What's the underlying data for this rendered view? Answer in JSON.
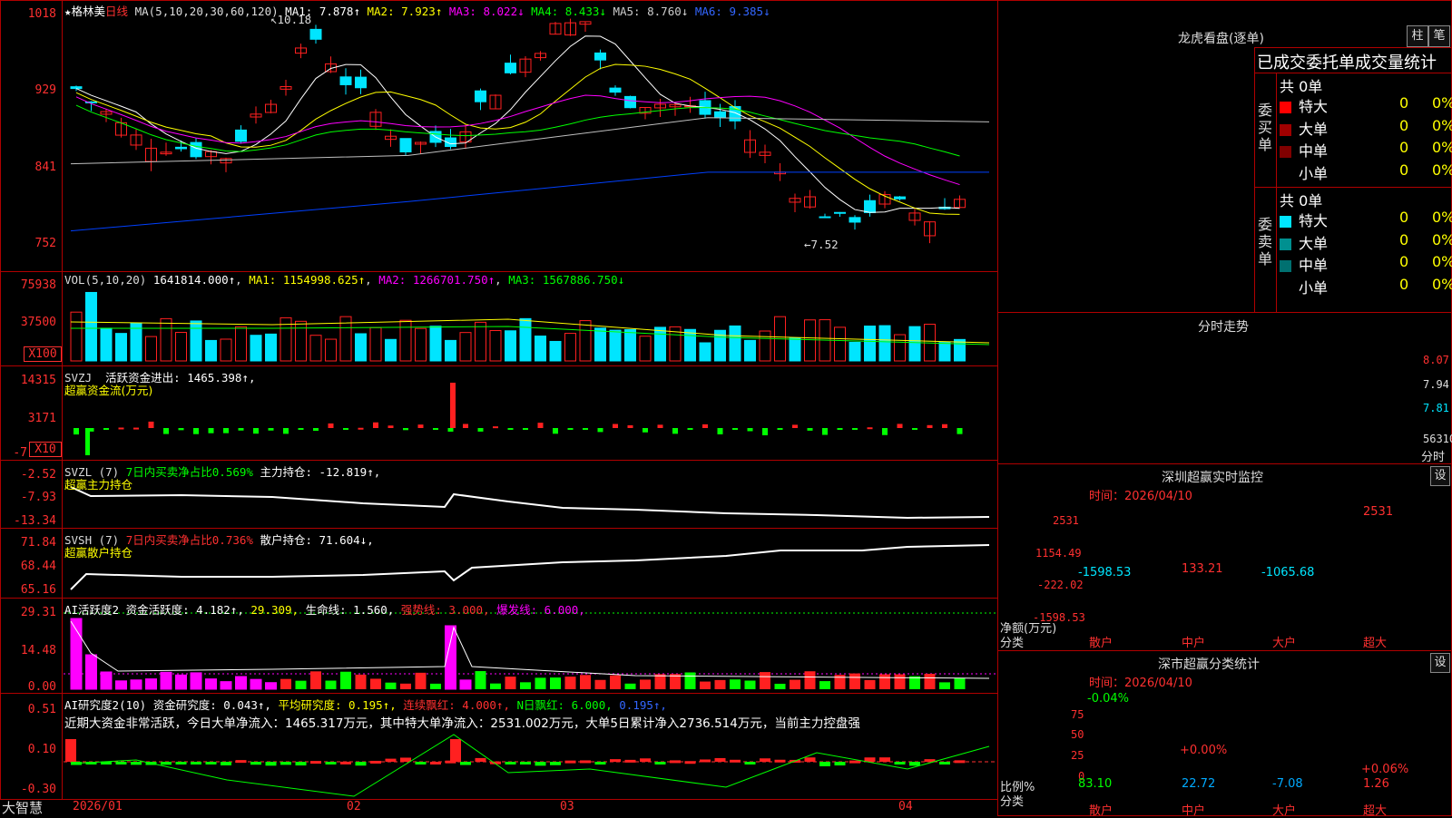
{
  "colors": {
    "up": "#ff2020",
    "down": "#00e5ff",
    "grid": "#b00000",
    "ma1": "#ffffff",
    "ma2": "#ffff00",
    "ma3": "#ff00ff",
    "ma4": "#00ff00",
    "ma5": "#c0c0c0",
    "ma6": "#0040ff"
  },
  "main": {
    "name": "格林美",
    "period": "日线",
    "ma_label": "MA(5,10,20,30,60,120)",
    "ma": [
      {
        "k": "MA1",
        "v": "7.878↑"
      },
      {
        "k": "MA2",
        "v": "7.923↑"
      },
      {
        "k": "MA3",
        "v": "8.022↓"
      },
      {
        "k": "MA4",
        "v": "8.433↓"
      },
      {
        "k": "MA5",
        "v": "8.760↓"
      },
      {
        "k": "MA6",
        "v": "9.385↓"
      }
    ],
    "y_ticks": [
      "1018",
      "929",
      "841",
      "752"
    ],
    "high_label": "10.18",
    "low_label": "7.52"
  },
  "vol": {
    "label": "VOL(5,10,20)",
    "value": "1641814.000↑",
    "ma1": "MA1: 1154998.625↑",
    "ma2": "MA2: 1266701.750↑",
    "ma3": "MA3: 1567886.750↓",
    "y_ticks": [
      "75938",
      "37500"
    ],
    "unit": "X100"
  },
  "svzj": {
    "label": "SVZJ",
    "desc": "活跃资金进出: 1465.398↑,",
    "sub": "超赢资金流(万元)",
    "y_ticks": [
      "14315",
      "3171",
      "-7"
    ],
    "unit": "X10"
  },
  "svzl": {
    "label": "SVZL (7)",
    "desc1": "7日内买卖净占比0.569%",
    "desc2": "主力持仓: -12.819↑,",
    "sub": "超赢主力持仓",
    "y_ticks": [
      "-2.52",
      "-7.93",
      "-13.34"
    ]
  },
  "svsh": {
    "label": "SVSH (7)",
    "desc1": "7日内买卖净占比0.736%",
    "desc2": "散户持仓: 71.604↓,",
    "sub": "超赢散户持仓",
    "y_ticks": [
      "71.84",
      "68.44",
      "65.16"
    ]
  },
  "ai1": {
    "label": "AI活跃度2",
    "v1": "资金活跃度: 4.182↑,",
    "v2": "29.309,",
    "v3": "生命线: 1.560,",
    "v4": "强势线: 3.000,",
    "v5": "爆发线: 6.000,",
    "y_ticks": [
      "29.31",
      "14.48",
      "0.00"
    ]
  },
  "ai2": {
    "label": "AI研究度2(10)",
    "v1": "资金研究度: 0.043↑,",
    "v2": "平均研究度: 0.195↑,",
    "v3": "连续飘红: 4.000↑,",
    "v4": "N日飘红: 6.000,",
    "v5": "0.195↑,",
    "text": "近期大资金非常活跃，今日大单净流入：1465.317万元，其中特大单净流入：2531.002万元，大单5日累计净入2736.514万元，当前主力控盘强",
    "y_ticks": [
      "0.51",
      "0.10",
      "-0.30"
    ]
  },
  "x_axis": {
    "brand": "大智慧",
    "labels": [
      "2026/01",
      "02",
      "03",
      "04"
    ]
  },
  "right": {
    "title": "龙虎看盘(逐单)",
    "btn_zhu": "柱",
    "btn_bi": "笔",
    "tabs": "已成交委托单成交量统计",
    "buy_label": "委买单",
    "sell_label": "委卖单",
    "buy_total": "共 0单",
    "sell_total": "共 0单",
    "rows": [
      {
        "name": "特大",
        "n": "0",
        "p": "0%"
      },
      {
        "name": "大单",
        "n": "0",
        "p": "0%"
      },
      {
        "name": "中单",
        "n": "0",
        "p": "0%"
      },
      {
        "name": "小单",
        "n": "0",
        "p": "0%"
      }
    ],
    "fenshi_title": "分时走势",
    "fenshi_y": [
      "8.07",
      "7.94",
      "7.81"
    ],
    "fenshi_vol": "56310",
    "fenshi_unit": "分时",
    "sz_title": "深圳超赢实时监控",
    "sz_btn": "设",
    "sz_date": "时间：2026/04/10",
    "sz_y": [
      "2531",
      "1154.49",
      "-222.02",
      "-1598.53"
    ],
    "sz_ylabel": "净额(万元)",
    "sz_xlabel": "分类",
    "sz_cats": [
      "散户",
      "中户",
      "大户",
      "超大"
    ],
    "sz_vals": [
      "-1598.53",
      "133.21",
      "-1065.68",
      "2531"
    ],
    "sc_title": "深市超赢分类统计",
    "sc_btn": "设",
    "sc_date": "时间：2026/04/10",
    "sc_y": [
      "75",
      "50",
      "25",
      "0"
    ],
    "sc_ylabel": "比例%",
    "sc_xlabel": "分类",
    "sc_cats": [
      "散户",
      "中户",
      "大户",
      "超大"
    ],
    "sc_vals": [
      "83.10",
      "22.72",
      "-7.08",
      "1.26"
    ],
    "sc_top": [
      "-0.04%",
      "+0.00%",
      "",
      "+0.06%"
    ]
  }
}
